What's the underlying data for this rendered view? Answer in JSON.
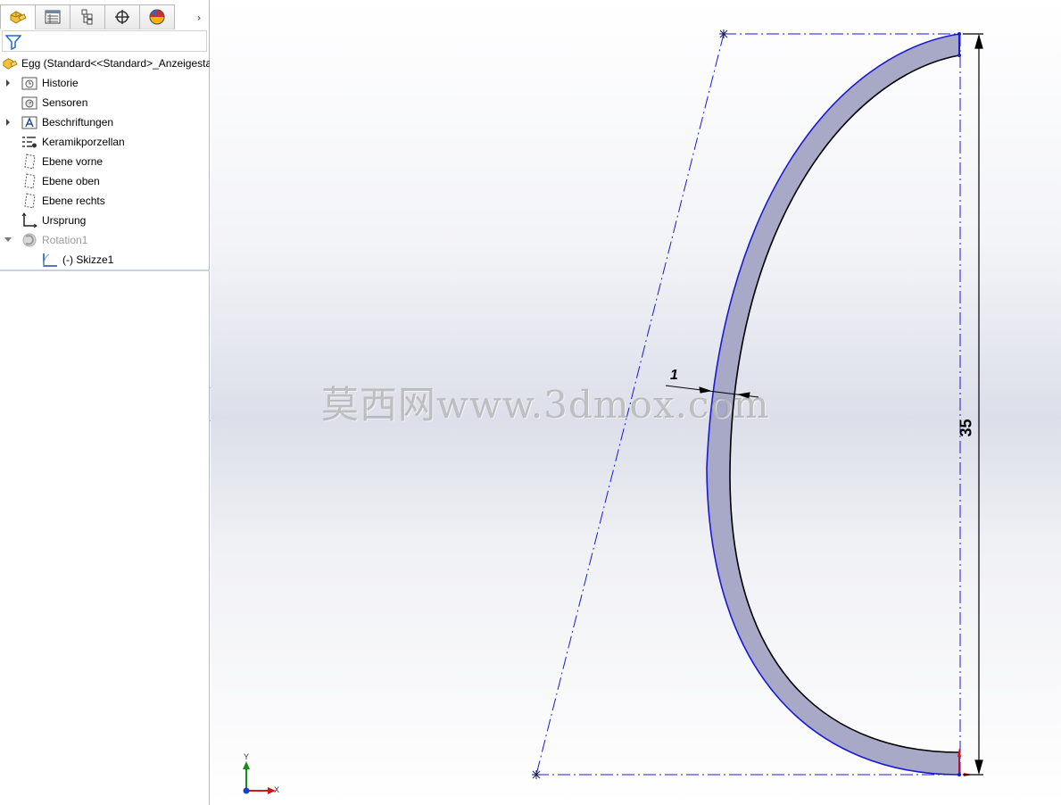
{
  "feature_manager": {
    "tabs": [
      {
        "id": "feature-manager",
        "icon": "part-icon",
        "active": true
      },
      {
        "id": "property-manager",
        "icon": "property-list-icon",
        "active": false
      },
      {
        "id": "configuration-manager",
        "icon": "configuration-icon",
        "active": false
      },
      {
        "id": "dimxpert-manager",
        "icon": "crosshair-icon",
        "active": false
      },
      {
        "id": "display-manager",
        "icon": "appearance-ball-icon",
        "active": false
      }
    ],
    "more_tabs_glyph": "›",
    "filter_icon": "filter-icon",
    "tree": [
      {
        "label": "Egg  (Standard<<Standard>_Anzeigesta",
        "icon": "part-icon",
        "expander": "none",
        "indent": 0,
        "dim": false
      },
      {
        "label": "Historie",
        "icon": "history-folder-icon",
        "expander": "collapsed",
        "indent": 1,
        "dim": false
      },
      {
        "label": "Sensoren",
        "icon": "sensor-folder-icon",
        "expander": "none",
        "indent": 1,
        "dim": false
      },
      {
        "label": "Beschriftungen",
        "icon": "annotations-folder-icon",
        "expander": "collapsed",
        "indent": 1,
        "dim": false
      },
      {
        "label": "Keramikporzellan",
        "icon": "material-icon",
        "expander": "none",
        "indent": 1,
        "dim": false
      },
      {
        "label": "Ebene vorne",
        "icon": "plane-icon",
        "expander": "none",
        "indent": 1,
        "dim": false
      },
      {
        "label": "Ebene oben",
        "icon": "plane-icon",
        "expander": "none",
        "indent": 1,
        "dim": false
      },
      {
        "label": "Ebene rechts",
        "icon": "plane-icon",
        "expander": "none",
        "indent": 1,
        "dim": false
      },
      {
        "label": "Ursprung",
        "icon": "origin-icon",
        "expander": "none",
        "indent": 1,
        "dim": false
      },
      {
        "label": "Rotation1",
        "icon": "revolve-icon",
        "expander": "expanded",
        "indent": 1,
        "dim": true
      },
      {
        "label": "(-) Skizze1",
        "icon": "sketch-icon",
        "expander": "none",
        "indent": 2,
        "dim": false
      }
    ]
  },
  "graphics": {
    "dimension_thickness": "1",
    "dimension_height": "35",
    "watermark": "莫西网www.3dmox.com",
    "triad": {
      "x_label": "X",
      "y_label": "Y"
    },
    "colors": {
      "profile_fill": "#a7a9c7",
      "profile_edge": "#1a1acc",
      "centerline": "#1a1acc",
      "dimension": "#000000"
    }
  }
}
